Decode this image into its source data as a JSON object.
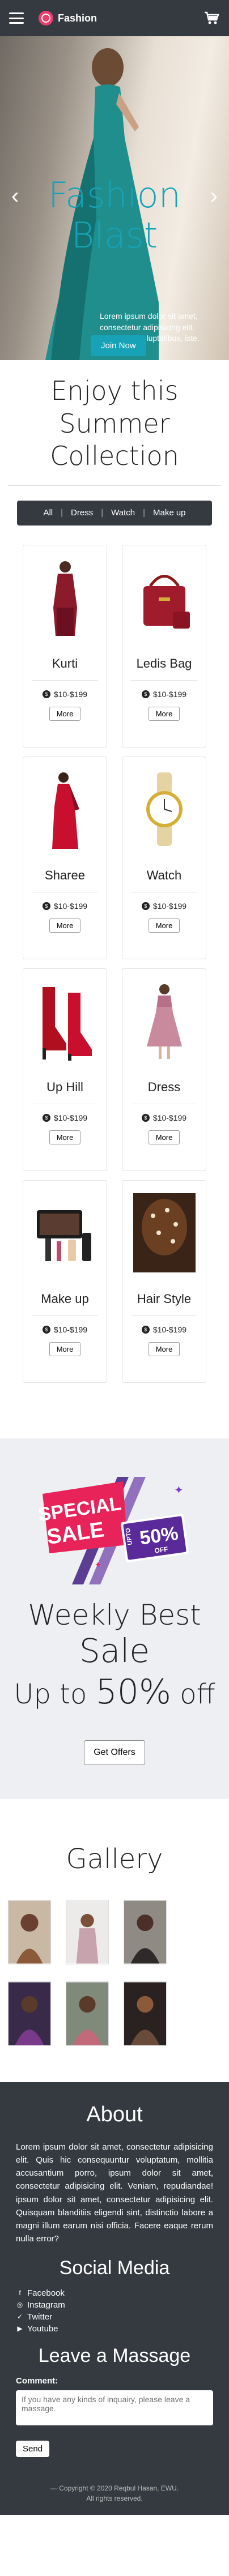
{
  "nav": {
    "brand": "Fashion",
    "cart_count": ""
  },
  "hero": {
    "title_line1": "Fashion",
    "title_line2": "Blast",
    "subtitle": "Lorem ipsum dolor sit amet, consectetur adipisicing elit. Quisquam voluptatibus, iste.",
    "button": "Join Now",
    "prev_arrow": "‹",
    "next_arrow": "›"
  },
  "collection": {
    "title": "Enjoy this Summer Collection",
    "filters": [
      "All",
      "Dress",
      "Watch",
      "Make up"
    ],
    "separator": "|",
    "products": [
      {
        "name": "Kurti",
        "price": "$10-$199",
        "more": "More"
      },
      {
        "name": "Ledis Bag",
        "price": "$10-$199",
        "more": "More"
      },
      {
        "name": "Sharee",
        "price": "$10-$199",
        "more": "More"
      },
      {
        "name": "Watch",
        "price": "$10-$199",
        "more": "More"
      },
      {
        "name": "Up Hill",
        "price": "$10-$199",
        "more": "More"
      },
      {
        "name": "Dress",
        "price": "$10-$199",
        "more": "More"
      },
      {
        "name": "Make up",
        "price": "$10-$199",
        "more": "More"
      },
      {
        "name": "Hair Style",
        "price": "$10-$199",
        "more": "More"
      }
    ]
  },
  "promo": {
    "badge_line1": "SPECIAL",
    "badge_line2": "SALE",
    "badge_upto": "UPTO",
    "badge_percent": "50%",
    "badge_off": "OFF",
    "line1": "Weekly Best",
    "line2": "Sale",
    "line3_prefix": "Up to",
    "line3_value": "50%",
    "line3_suffix": "off",
    "button": "Get Offers"
  },
  "gallery": {
    "title": "Gallery"
  },
  "footer": {
    "about_title": "About",
    "about_text": "Lorem ipsum dolor sit amet, consectetur adipisicing elit. Quis hic consequuntur voluptatum, mollitia accusantium porro, ipsum dolor sit amet, consectetur adipisicing elit. Veniam, repudiandae! ipsum dolor sit amet, consectetur adipisicing elit. Quisquam blanditiis eligendi sint, distinctio labore a magni illum earum nisi officia. Facere eaque rerum nulla error?",
    "social_title": "Social Media",
    "social": [
      "Facebook",
      "Instagram",
      "Twitter",
      "Youtube"
    ],
    "message_title": "Leave a Massage",
    "comment_label": "Comment:",
    "comment_placeholder": "If you have any kinds of inquairy, please leave a massage.",
    "send": "Send",
    "copyright": "— Copyright © 2020 Reqbul Hasan, EWU.",
    "rights": "All rights reserved."
  }
}
